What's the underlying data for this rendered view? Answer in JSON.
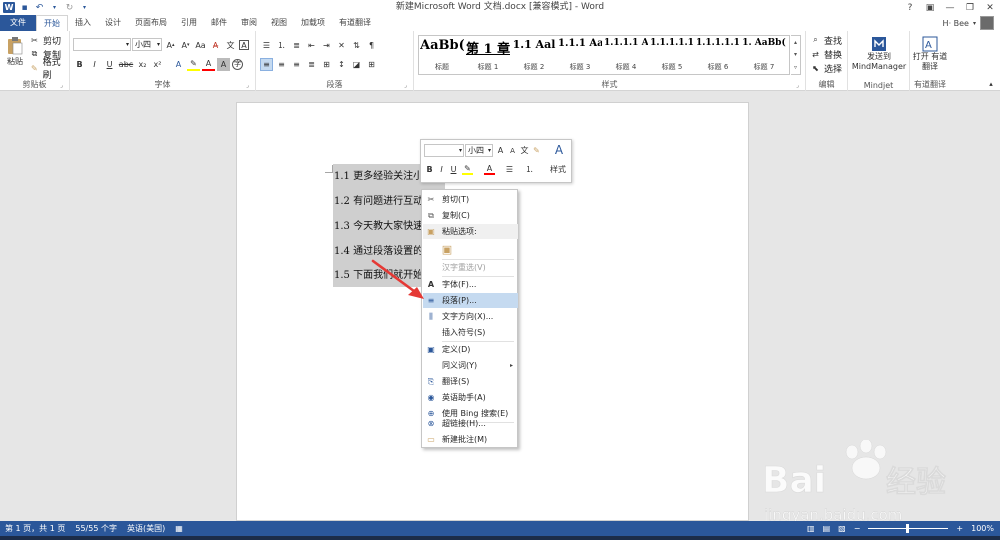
{
  "app": {
    "title": "新建Microsoft Word 文档.docx [兼容模式] - Word",
    "logo_letter": "W",
    "window_controls": [
      "?",
      "▣",
      "—",
      "❐",
      "✕"
    ]
  },
  "user": {
    "name": "H· Bee",
    "menu_caret": "▾"
  },
  "tabs": [
    "文件",
    "开始",
    "插入",
    "设计",
    "页面布局",
    "引用",
    "邮件",
    "审阅",
    "视图",
    "加载项",
    "有道翻译"
  ],
  "ribbon": {
    "clipboard": {
      "label": "剪贴板",
      "paste": "粘贴",
      "cut": "剪切",
      "copy": "复制",
      "format_painter": "格式刷"
    },
    "font": {
      "label": "字体",
      "font_name": "",
      "font_size": "小四",
      "bold": "B",
      "italic": "I",
      "underline": "U",
      "strike": "abc",
      "sub": "x₂",
      "sup": "x²"
    },
    "paragraph": {
      "label": "段落"
    },
    "styles": {
      "label": "样式",
      "items": [
        {
          "sample": "AaBb(",
          "name": "标题"
        },
        {
          "sample": "第 1 章",
          "name": "标题 1"
        },
        {
          "sample": "1.1  Aal",
          "name": "标题 2"
        },
        {
          "sample": "1.1.1  Aa",
          "name": "标题 3"
        },
        {
          "sample": "1.1.1.1  A",
          "name": "标题 4"
        },
        {
          "sample": "1.1.1.1.1",
          "name": "标题 5"
        },
        {
          "sample": "1.1.1.1.1.",
          "name": "标题 6"
        },
        {
          "sample": "1.  AaBb(",
          "name": "标题 7"
        }
      ]
    },
    "editing": {
      "label": "编辑",
      "find": "查找",
      "replace": "替换",
      "select": "选择"
    },
    "mindjet": {
      "label": "Mindjet",
      "button": "发送到 MindManager"
    },
    "youdao": {
      "label": "有道翻译",
      "button": "打开 有道翻译"
    }
  },
  "document": {
    "paragraphs": [
      "1.1 更多经验关注小",
      "1.2 有问题进行互动",
      "1.3 今天教大家快速",
      "1.4 通过段落设置的",
      "1.5 下面我们就开始"
    ]
  },
  "minibar": {
    "font_size": "小四",
    "styles": "样式"
  },
  "context_menu": {
    "items": [
      {
        "label": "剪切(T)",
        "icon": "scissors-icon",
        "glyph": "✂",
        "state": "normal"
      },
      {
        "label": "复制(C)",
        "icon": "copy-icon",
        "glyph": "⧉",
        "state": "normal"
      },
      {
        "label": "粘贴选项:",
        "icon": "clipboard-icon",
        "glyph": "📋",
        "state": "section"
      },
      {
        "label": "",
        "icon": "paste-keep-format-icon",
        "glyph": "📋",
        "state": "normal"
      },
      {
        "label": "汉字重选(V)",
        "icon": "",
        "glyph": "",
        "state": "disabled"
      },
      {
        "label": "字体(F)...",
        "icon": "font-icon",
        "glyph": "A",
        "state": "normal"
      },
      {
        "label": "段落(P)...",
        "icon": "paragraph-icon",
        "glyph": "≡",
        "state": "hover"
      },
      {
        "label": "文字方向(X)...",
        "icon": "text-direction-icon",
        "glyph": "⫼",
        "state": "normal"
      },
      {
        "label": "插入符号(S)",
        "icon": "",
        "glyph": "",
        "state": "normal"
      },
      {
        "label": "定义(D)",
        "icon": "define-icon",
        "glyph": "▣",
        "state": "normal"
      },
      {
        "label": "同义词(Y)",
        "icon": "",
        "glyph": "",
        "state": "normal",
        "submenu": "▸"
      },
      {
        "label": "翻译(S)",
        "icon": "translate-icon",
        "glyph": "⎘",
        "state": "normal"
      },
      {
        "label": "英语助手(A)",
        "icon": "english-assistant-icon",
        "glyph": "◉",
        "state": "normal"
      },
      {
        "label": "使用 Bing 搜索(E)",
        "icon": "bing-search-icon",
        "glyph": "⊕",
        "state": "normal"
      },
      {
        "label": "超链接(H)...",
        "icon": "hyperlink-icon",
        "glyph": "⊗",
        "state": "normal"
      },
      {
        "label": "新建批注(M)",
        "icon": "new-comment-icon",
        "glyph": "▭",
        "state": "normal"
      }
    ]
  },
  "status": {
    "page": "第 1 页，共 1 页",
    "words": "55/55 个字",
    "language": "英语(美国)",
    "zoom_minus": "−",
    "zoom_plus": "+",
    "zoom": "100%"
  },
  "watermark": {
    "brand": "Bai",
    "brand_cn": "经验",
    "url": "jingyan.baidu.com"
  },
  "colors": {
    "accent": "#2b579a",
    "selection": "#cfcfcf",
    "menu_hover": "#c5daf0",
    "arrow": "#e53935"
  }
}
